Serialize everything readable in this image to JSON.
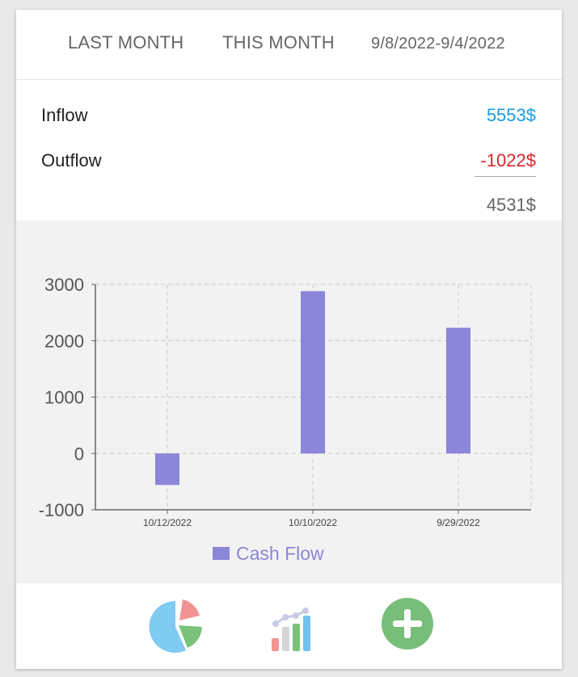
{
  "tabs": {
    "last_month": "LAST MONTH",
    "this_month": "THIS MONTH",
    "date_range": "9/8/2022-9/4/2022"
  },
  "summary": {
    "inflow_label": "Inflow",
    "inflow_value": "5553$",
    "outflow_label": "Outflow",
    "outflow_value": "-1022$",
    "net_value": "4531$"
  },
  "colors": {
    "inflow": "#1a9be0",
    "outflow": "#d9262a",
    "net": "#666666",
    "bar": "#8b86d8"
  },
  "chart_data": {
    "type": "bar",
    "categories": [
      "10/12/2022",
      "10/10/2022",
      "9/29/2022"
    ],
    "series": [
      {
        "name": "Cash Flow",
        "values": [
          -560,
          2880,
          2230
        ]
      }
    ],
    "ylim": [
      -1000,
      3000
    ],
    "yticks": [
      3000,
      2000,
      1000,
      0,
      -1000
    ],
    "grid": true,
    "legend_position": "bottom"
  },
  "legend": {
    "label": "Cash Flow"
  },
  "bottom_nav": [
    {
      "icon": "pie-chart-icon"
    },
    {
      "icon": "bar-chart-icon"
    },
    {
      "icon": "add-icon"
    }
  ]
}
